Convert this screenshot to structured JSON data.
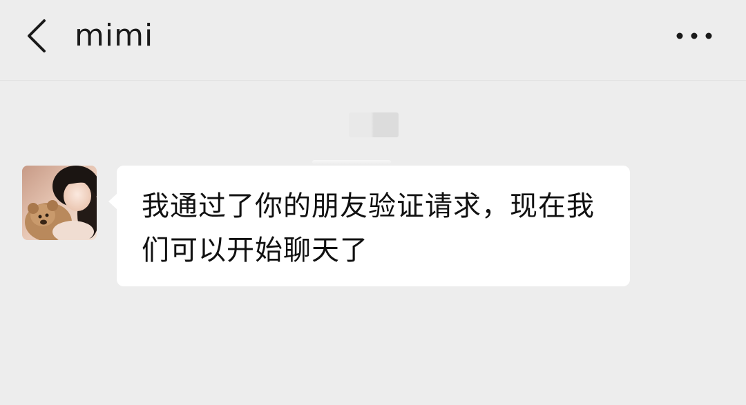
{
  "header": {
    "title": "mimi",
    "back_icon": "chevron-left-icon",
    "more_icon": "more-horizontal-icon"
  },
  "chat": {
    "messages": [
      {
        "sender": "mimi",
        "direction": "incoming",
        "text": "我通过了你的朋友验证请求，现在我们可以开始聊天了"
      }
    ]
  },
  "colors": {
    "background": "#ededed",
    "bubble": "#ffffff",
    "text": "#111111"
  }
}
